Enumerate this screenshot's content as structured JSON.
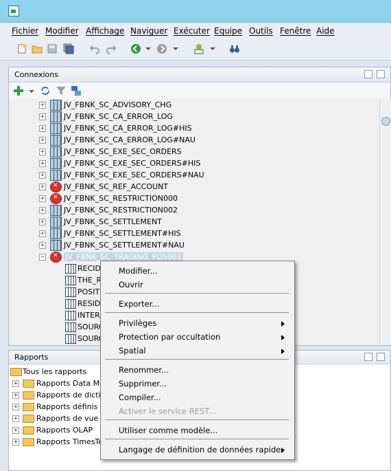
{
  "menubar": {
    "items": [
      "Fichier",
      "Modifier",
      "Affichage",
      "Naviguer",
      "Exécuter",
      "Equipe",
      "Outils",
      "Fenêtre",
      "Aide"
    ]
  },
  "toolbar": {
    "icons": [
      "new-icon",
      "open-icon",
      "save-icon",
      "save-all-icon",
      "undo-icon",
      "redo-icon",
      "back-icon",
      "forward-icon",
      "sql-icon",
      "binoculars-icon"
    ]
  },
  "connexions": {
    "title": "Connexions",
    "tree_items": [
      {
        "label": "JV_FBNK_SC_ADVISORY_CHG",
        "status": "ok"
      },
      {
        "label": "JV_FBNK_SC_CA_ERROR_LOG",
        "status": "ok"
      },
      {
        "label": "JV_FBNK_SC_CA_ERROR_LOG#HIS",
        "status": "ok"
      },
      {
        "label": "JV_FBNK_SC_CA_ERROR_LOG#NAU",
        "status": "ok"
      },
      {
        "label": "JV_FBNK_SC_EXE_SEC_ORDERS",
        "status": "ok"
      },
      {
        "label": "JV_FBNK_SC_EXE_SEC_ORDERS#HIS",
        "status": "ok"
      },
      {
        "label": "JV_FBNK_SC_EXE_SEC_ORDERS#NAU",
        "status": "ok"
      },
      {
        "label": "JV_FBNK_SC_REF_ACCOUNT",
        "status": "error"
      },
      {
        "label": "JV_FBNK_SC_RESTRICTION000",
        "status": "error"
      },
      {
        "label": "JV_FBNK_SC_RESTRICTION002",
        "status": "ok"
      },
      {
        "label": "JV_FBNK_SC_SETTLEMENT",
        "status": "ok"
      },
      {
        "label": "JV_FBNK_SC_SETTLEMENT#HIS",
        "status": "ok"
      },
      {
        "label": "JV_FBNK_SC_SETTLEMENT#NAU",
        "status": "ok"
      },
      {
        "label": "JV_FBNK_SC_TRADING_POS001",
        "status": "error",
        "selected": true
      }
    ],
    "columns": [
      "RECID",
      "THE_R",
      "POSITI",
      "RESIDE",
      "INTERE",
      "SOURC",
      "SOURC"
    ]
  },
  "rapports": {
    "title": "Rapports",
    "root": "Tous les rapports",
    "items": [
      "Rapports Data Mod",
      "Rapports de diction",
      "Rapports définis pa",
      "Rapports de vue ar",
      "Rapports OLAP",
      "Rapports TimesTen"
    ]
  },
  "context_menu": {
    "modifier": "Modifier...",
    "ouvrir": "Ouvrir",
    "exporter": "Exporter...",
    "privileges": "Privilèges",
    "protection": "Protection par occultation",
    "spatial": "Spatial",
    "renommer": "Renommer...",
    "supprimer": "Supprimer...",
    "compiler": "Compiler...",
    "activer_rest": "Activer le service REST...",
    "utiliser_modele": "Utiliser comme modèle...",
    "langage_ddl": "Langage de définition de données rapide"
  }
}
